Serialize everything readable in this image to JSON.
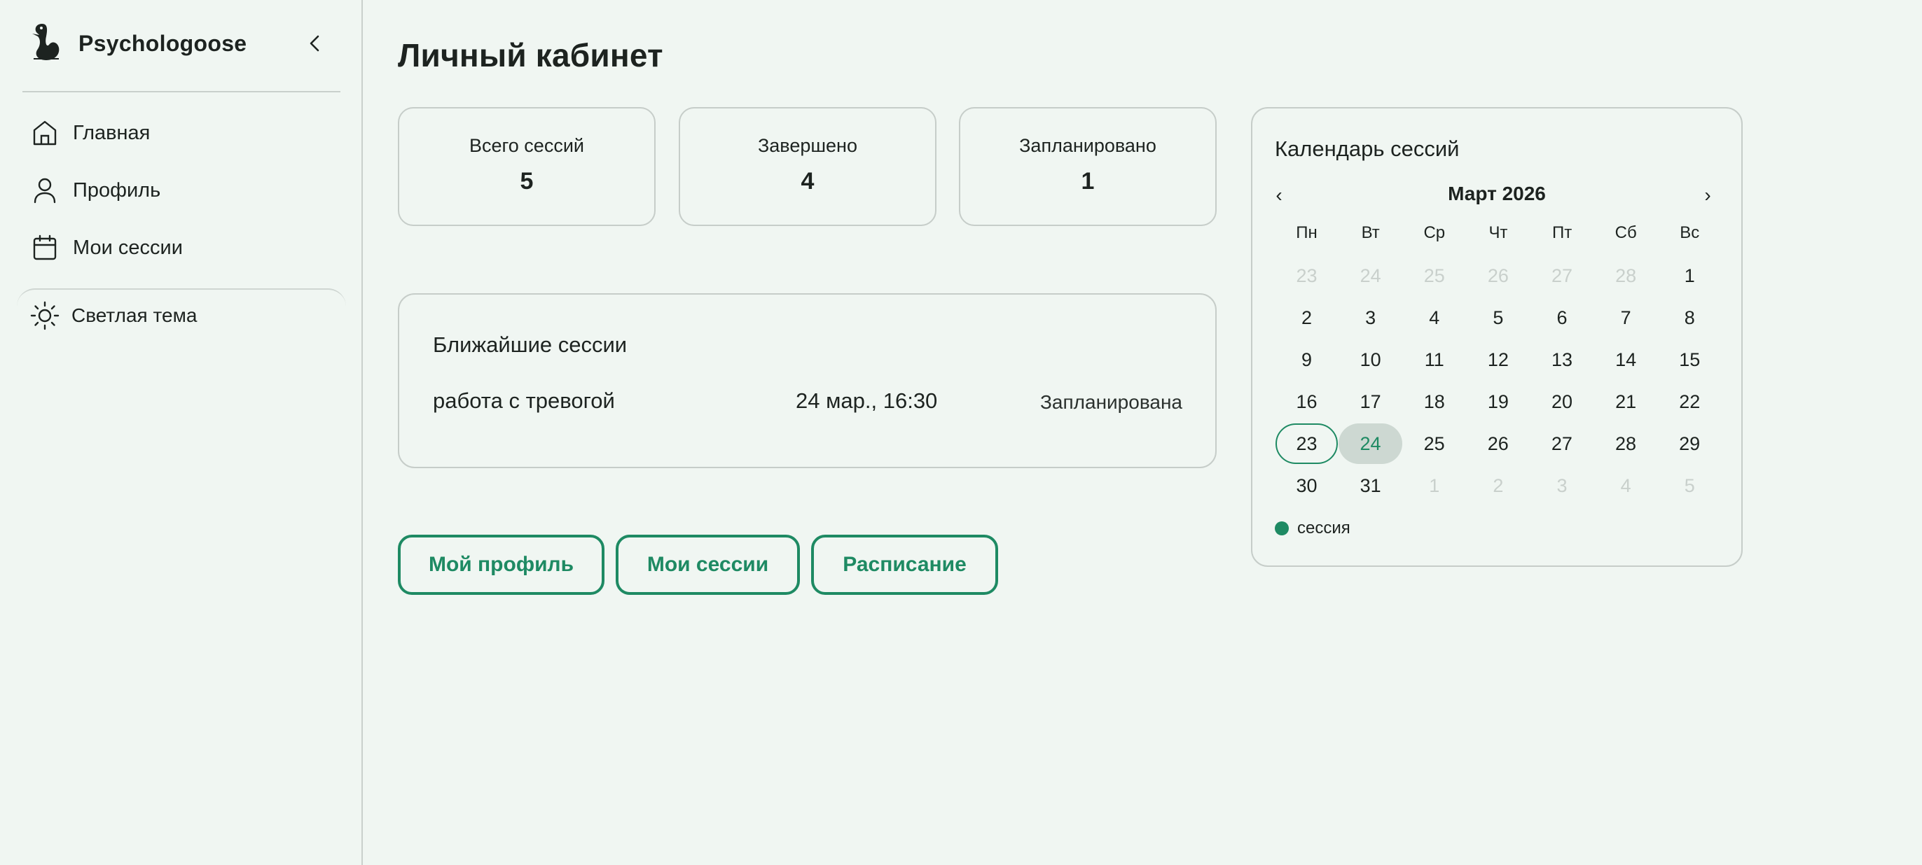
{
  "brand": {
    "name": "Psychologoose"
  },
  "sidebar": {
    "items": [
      {
        "label": "Главная",
        "icon": "home-icon"
      },
      {
        "label": "Профиль",
        "icon": "user-icon"
      },
      {
        "label": "Мои сессии",
        "icon": "calendar-icon"
      }
    ],
    "theme_toggle": {
      "label": "Светлая тема",
      "icon": "sun-icon"
    }
  },
  "page": {
    "title": "Личный кабинет"
  },
  "stats": [
    {
      "label": "Всего сессий",
      "value": "5"
    },
    {
      "label": "Завершено",
      "value": "4"
    },
    {
      "label": "Запланировано",
      "value": "1"
    }
  ],
  "upcoming": {
    "title": "Ближайшие сессии",
    "sessions": [
      {
        "name": "работа с тревогой",
        "date": "24 мар., 16:30",
        "status": "Запланирована"
      }
    ]
  },
  "actions": [
    {
      "label": "Мой профиль"
    },
    {
      "label": "Мои сессии"
    },
    {
      "label": "Расписание"
    }
  ],
  "calendar": {
    "title": "Календарь сессий",
    "prev": "‹",
    "next": "›",
    "month": "Март 2026",
    "weekdays": [
      "Пн",
      "Вт",
      "Ср",
      "Чт",
      "Пт",
      "Сб",
      "Вс"
    ],
    "weeks": [
      [
        {
          "d": "23",
          "m": true
        },
        {
          "d": "24",
          "m": true
        },
        {
          "d": "25",
          "m": true
        },
        {
          "d": "26",
          "m": true
        },
        {
          "d": "27",
          "m": true
        },
        {
          "d": "28",
          "m": true
        },
        {
          "d": "1"
        }
      ],
      [
        {
          "d": "2"
        },
        {
          "d": "3"
        },
        {
          "d": "4"
        },
        {
          "d": "5"
        },
        {
          "d": "6"
        },
        {
          "d": "7"
        },
        {
          "d": "8"
        }
      ],
      [
        {
          "d": "9"
        },
        {
          "d": "10"
        },
        {
          "d": "11"
        },
        {
          "d": "12"
        },
        {
          "d": "13"
        },
        {
          "d": "14"
        },
        {
          "d": "15"
        }
      ],
      [
        {
          "d": "16"
        },
        {
          "d": "17"
        },
        {
          "d": "18"
        },
        {
          "d": "19"
        },
        {
          "d": "20"
        },
        {
          "d": "21"
        },
        {
          "d": "22"
        }
      ],
      [
        {
          "d": "23",
          "today": true
        },
        {
          "d": "24",
          "session": true
        },
        {
          "d": "25"
        },
        {
          "d": "26"
        },
        {
          "d": "27"
        },
        {
          "d": "28"
        },
        {
          "d": "29"
        }
      ],
      [
        {
          "d": "30"
        },
        {
          "d": "31"
        },
        {
          "d": "1",
          "m": true
        },
        {
          "d": "2",
          "m": true
        },
        {
          "d": "3",
          "m": true
        },
        {
          "d": "4",
          "m": true
        },
        {
          "d": "5",
          "m": true
        }
      ]
    ],
    "legend": "сессия"
  },
  "colors": {
    "accent": "#1e8a63",
    "background": "#f0f6f2",
    "border": "#c6cdc9",
    "session_day_bg": "#cdd8d2",
    "muted": "#c9d0cc"
  }
}
